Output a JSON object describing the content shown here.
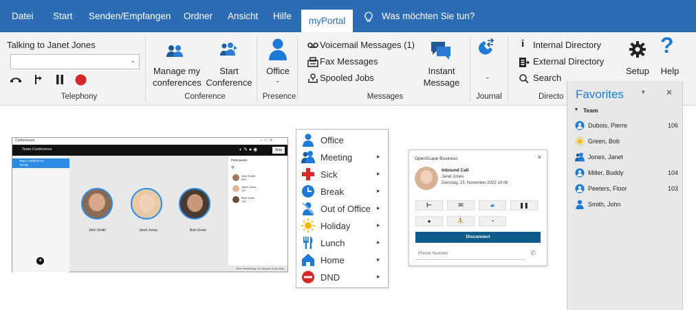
{
  "menubar": {
    "items": [
      "Datei",
      "Start",
      "Senden/Empfangen",
      "Ordner",
      "Ansicht",
      "Hilfe"
    ],
    "active_tab": "myPortal",
    "tell_me": "Was möchten Sie tun?"
  },
  "ribbon": {
    "telephony": {
      "talking_to": "Talking to Janet Jones",
      "group": "Telephony"
    },
    "conference": {
      "manage_line1": "Manage my",
      "manage_line2": "conferences",
      "start_line1": "Start",
      "start_line2": "Conference",
      "group": "Conference"
    },
    "presence": {
      "office": "Office",
      "group": "Presence"
    },
    "messages": {
      "voicemail": "Voicemail Messages (1)",
      "fax": "Fax Messages",
      "spooled": "Spooled Jobs",
      "im_line1": "Instant",
      "im_line2": "Message",
      "group": "Messages"
    },
    "journal": {
      "group": "Journal"
    },
    "directories": {
      "internal": "Internal Directory",
      "external": "External Directory",
      "search": "Search",
      "group": "Directo"
    },
    "setup": "Setup",
    "help": "Help"
  },
  "conference_window": {
    "title": "Conferences",
    "subtitle": "Team Conference",
    "stop": "Stop",
    "list_item_line1": "Team Conference",
    "list_item_line2": "TEAM",
    "participants_header": "Participants",
    "participants": [
      {
        "name": "John Smith",
        "sub": "200"
      },
      {
        "name": "Janet Jones",
        "sub": "107"
      },
      {
        "name": "Bob Green",
        "sub": "101"
      }
    ],
    "avatars": [
      {
        "label": "John Smith"
      },
      {
        "label": "Janet Jones"
      },
      {
        "label": "Bob Green"
      }
    ],
    "footer": "Time Remaining: 91 minutes 9 seconds"
  },
  "presence_menu": {
    "items": [
      {
        "label": "Office",
        "icon": "person-icon",
        "color": "#1e7ad6",
        "submenu": false
      },
      {
        "label": "Meeting",
        "icon": "meeting-icon",
        "color": "#1e7ad6",
        "submenu": true
      },
      {
        "label": "Sick",
        "icon": "red-cross-icon",
        "color": "#d62828",
        "submenu": true
      },
      {
        "label": "Break",
        "icon": "clock-icon",
        "color": "#1e7ad6",
        "submenu": true
      },
      {
        "label": "Out of Office",
        "icon": "out-of-office-icon",
        "color": "#1e7ad6",
        "submenu": true
      },
      {
        "label": "Holiday",
        "icon": "sun-icon",
        "color": "#f5b700",
        "submenu": true
      },
      {
        "label": "Lunch",
        "icon": "cutlery-icon",
        "color": "#1e7ad6",
        "submenu": true
      },
      {
        "label": "Home",
        "icon": "home-icon",
        "color": "#1e7ad6",
        "submenu": true
      },
      {
        "label": "DND",
        "icon": "do-not-disturb-icon",
        "color": "#d62828",
        "submenu": true
      }
    ]
  },
  "call_dialog": {
    "title": "OpenScape Business",
    "heading": "Inbound Call",
    "caller": "Janet Jones",
    "datetime": "Dienstag, 15. November 2022 14:08",
    "disconnect": "Disconnect",
    "phone_placeholder": "Phone Number"
  },
  "favorites": {
    "title": "Favorites",
    "group": "Team",
    "contacts": [
      {
        "name": "Dubois, Pierre",
        "ext": "106",
        "icon": "available-icon",
        "color": "#1e7ad6"
      },
      {
        "name": "Green, Bob",
        "ext": "",
        "icon": "sun-icon",
        "color": "#f5b700"
      },
      {
        "name": "Jones, Janet",
        "ext": "",
        "icon": "meeting-icon",
        "color": "#1e7ad6"
      },
      {
        "name": "Miller, Buddy",
        "ext": "104",
        "icon": "available-icon",
        "color": "#1e7ad6"
      },
      {
        "name": "Peeters, Floor",
        "ext": "103",
        "icon": "available-icon",
        "color": "#1e7ad6"
      },
      {
        "name": "Smith, John",
        "ext": "",
        "icon": "person-icon",
        "color": "#1e7ad6"
      }
    ]
  },
  "colors": {
    "accent": "#2b6cb5",
    "presence_blue": "#1e7ad6",
    "red": "#d62828",
    "holiday": "#f5b700",
    "disconnect": "#0e5a8a"
  }
}
